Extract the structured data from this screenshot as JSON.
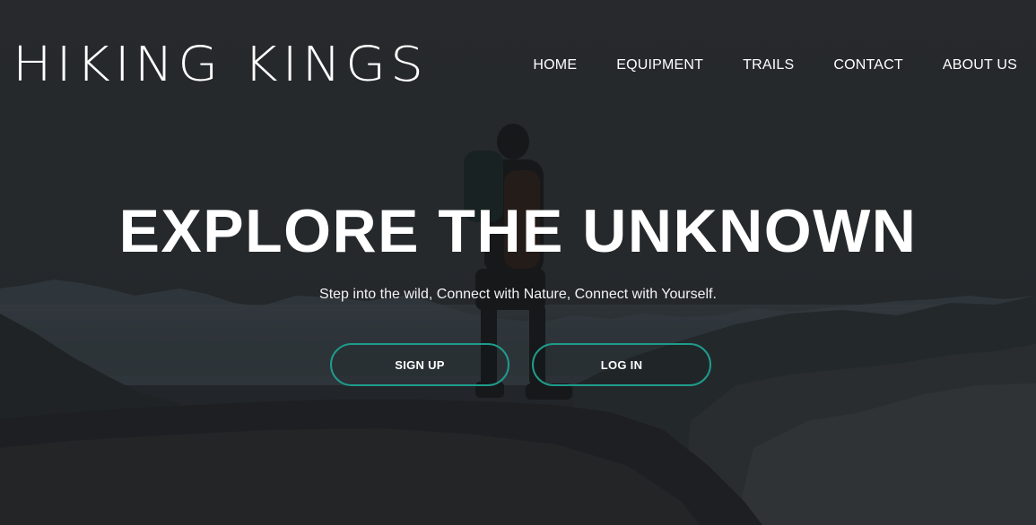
{
  "brand": {
    "logo_text": "HIKING KINGS"
  },
  "nav": {
    "items": [
      {
        "label": "HOME"
      },
      {
        "label": "EQUIPMENT"
      },
      {
        "label": "TRAILS"
      },
      {
        "label": "CONTACT"
      },
      {
        "label": "ABOUT US"
      }
    ]
  },
  "hero": {
    "headline": "EXPLORE THE UNKNOWN",
    "tagline": "Step into the wild, Connect with Nature, Connect with Yourself.",
    "signup_label": "SIGN UP",
    "login_label": "LOG IN"
  },
  "colors": {
    "background": "#2c3034",
    "button_border": "#1f9b8b",
    "text": "#ffffff"
  }
}
